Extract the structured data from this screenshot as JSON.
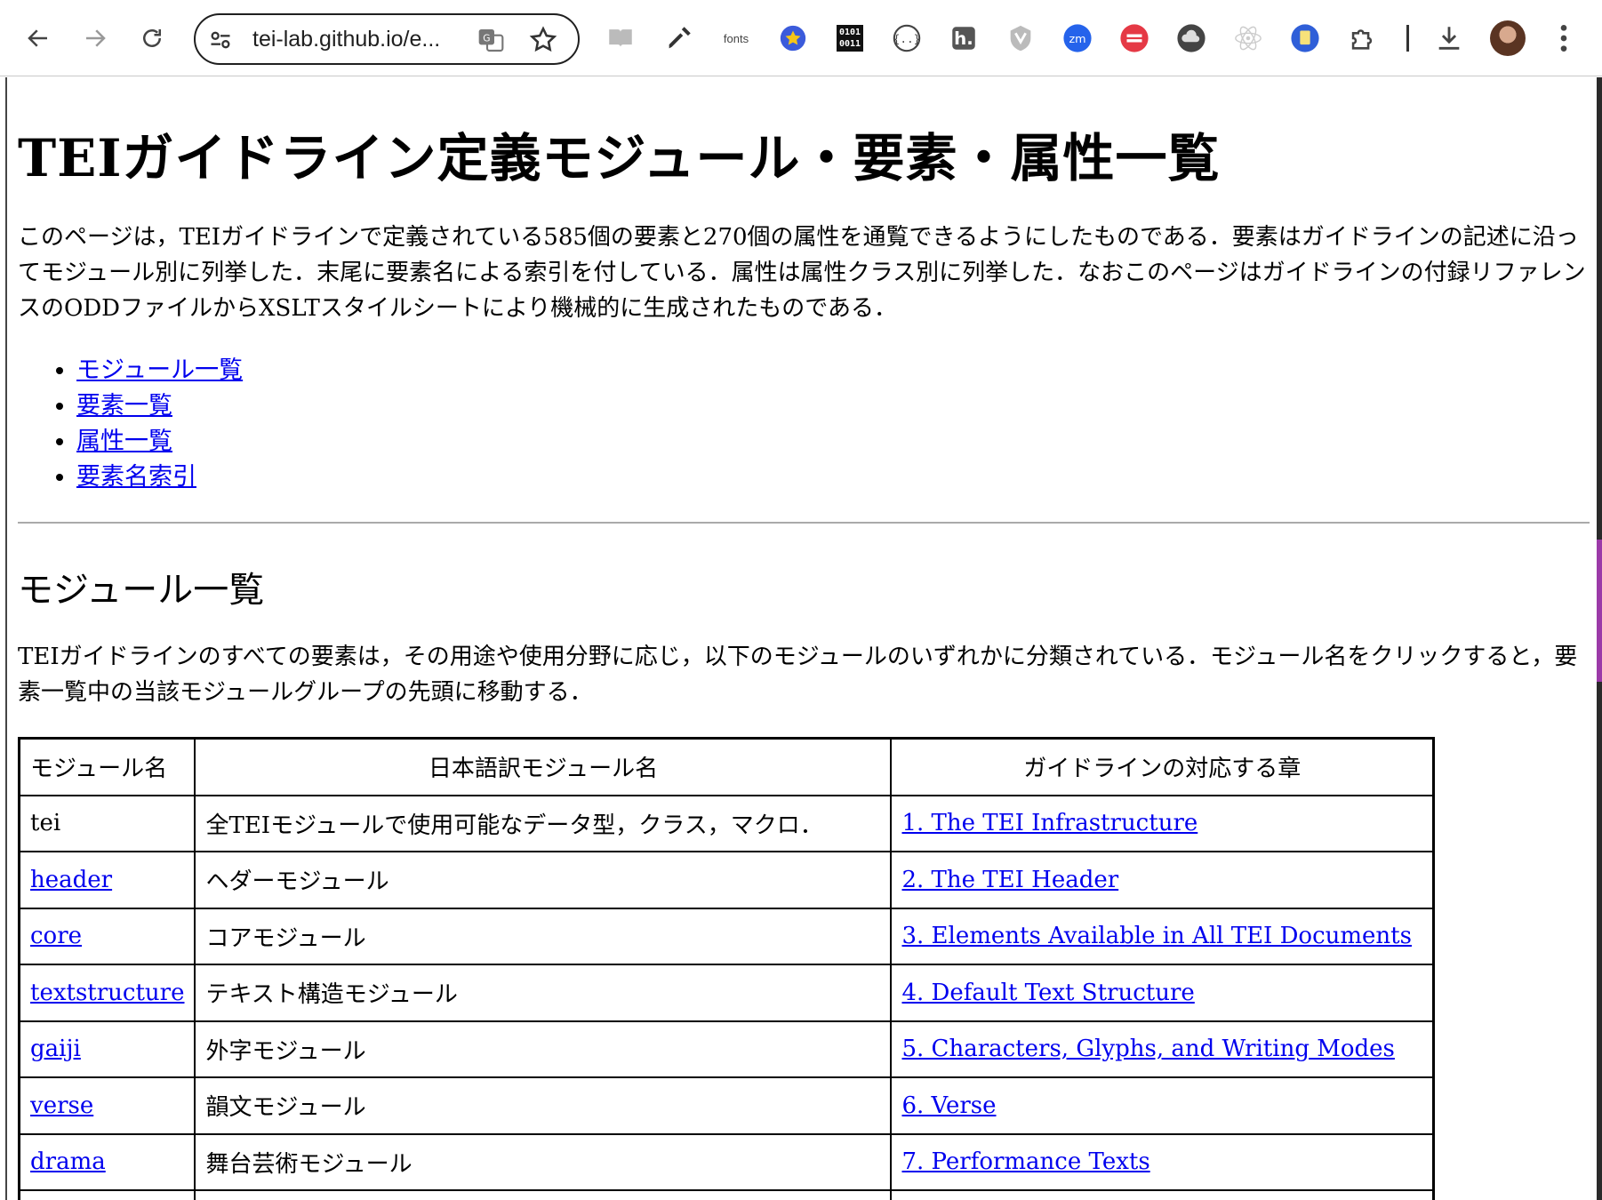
{
  "browser": {
    "url": "tei-lab.github.io/e...",
    "extensions": [
      "reader-icon",
      "eyedropper-icon",
      "fonts",
      "star-badge-icon",
      "0101\n0011",
      "code-braces-icon",
      "h-icon",
      "shield-icon",
      "zm",
      "stripes-icon",
      "cloud-icon",
      "react-icon",
      "doc-icon",
      "puzzle-icon"
    ],
    "fonts_label": "fonts",
    "bin_label_top": "0101",
    "bin_label_bottom": "0011",
    "zm_label": "zm"
  },
  "page": {
    "title": "TEIガイドライン定義モジュール・要素・属性一覧",
    "intro": "このページは，TEIガイドラインで定義されている585個の要素と270個の属性を通覧できるようにしたものである．要素はガイドラインの記述に沿ってモジュール別に列挙した．末尾に要素名による索引を付している．属性は属性クラス別に列挙した．なおこのページはガイドラインの付録リファレンスのODDファイルからXSLTスタイルシートにより機械的に生成されたものである．",
    "toc": [
      {
        "label": "モジュール一覧"
      },
      {
        "label": "要素一覧"
      },
      {
        "label": "属性一覧"
      },
      {
        "label": "要素名索引"
      }
    ],
    "modules_heading": "モジュール一覧",
    "modules_description": "TEIガイドラインのすべての要素は，その用途や使用分野に応じ，以下のモジュールのいずれかに分類されている．モジュール名をクリックすると，要素一覧中の当該モジュールグループの先頭に移動する．",
    "table": {
      "headers": [
        "モジュール名",
        "日本語訳モジュール名",
        "ガイドラインの対応する章"
      ],
      "rows": [
        {
          "module": "tei",
          "module_link": false,
          "ja": "全TEIモジュールで使用可能なデータ型，クラス，マクロ．",
          "chapter": "1. The TEI Infrastructure"
        },
        {
          "module": "header",
          "module_link": true,
          "ja": "ヘダーモジュール",
          "chapter": "2. The TEI Header"
        },
        {
          "module": "core",
          "module_link": true,
          "ja": "コアモジュール",
          "chapter": "3. Elements Available in All TEI Documents"
        },
        {
          "module": "textstructure",
          "module_link": true,
          "ja": "テキスト構造モジュール",
          "chapter": "4. Default Text Structure"
        },
        {
          "module": "gaiji",
          "module_link": true,
          "ja": "外字モジュール",
          "chapter": "5. Characters, Glyphs, and Writing Modes"
        },
        {
          "module": "verse",
          "module_link": true,
          "ja": "韻文モジュール",
          "chapter": "6. Verse"
        },
        {
          "module": "drama",
          "module_link": true,
          "ja": "舞台芸術モジュール",
          "chapter": "7. Performance Texts"
        },
        {
          "module": "",
          "module_link": true,
          "ja": "",
          "chapter": ""
        }
      ]
    }
  },
  "colors": {
    "link": "#0000ee",
    "text": "#000000",
    "zm_badge": "#2563eb",
    "stripes_badge": "#e53945"
  }
}
